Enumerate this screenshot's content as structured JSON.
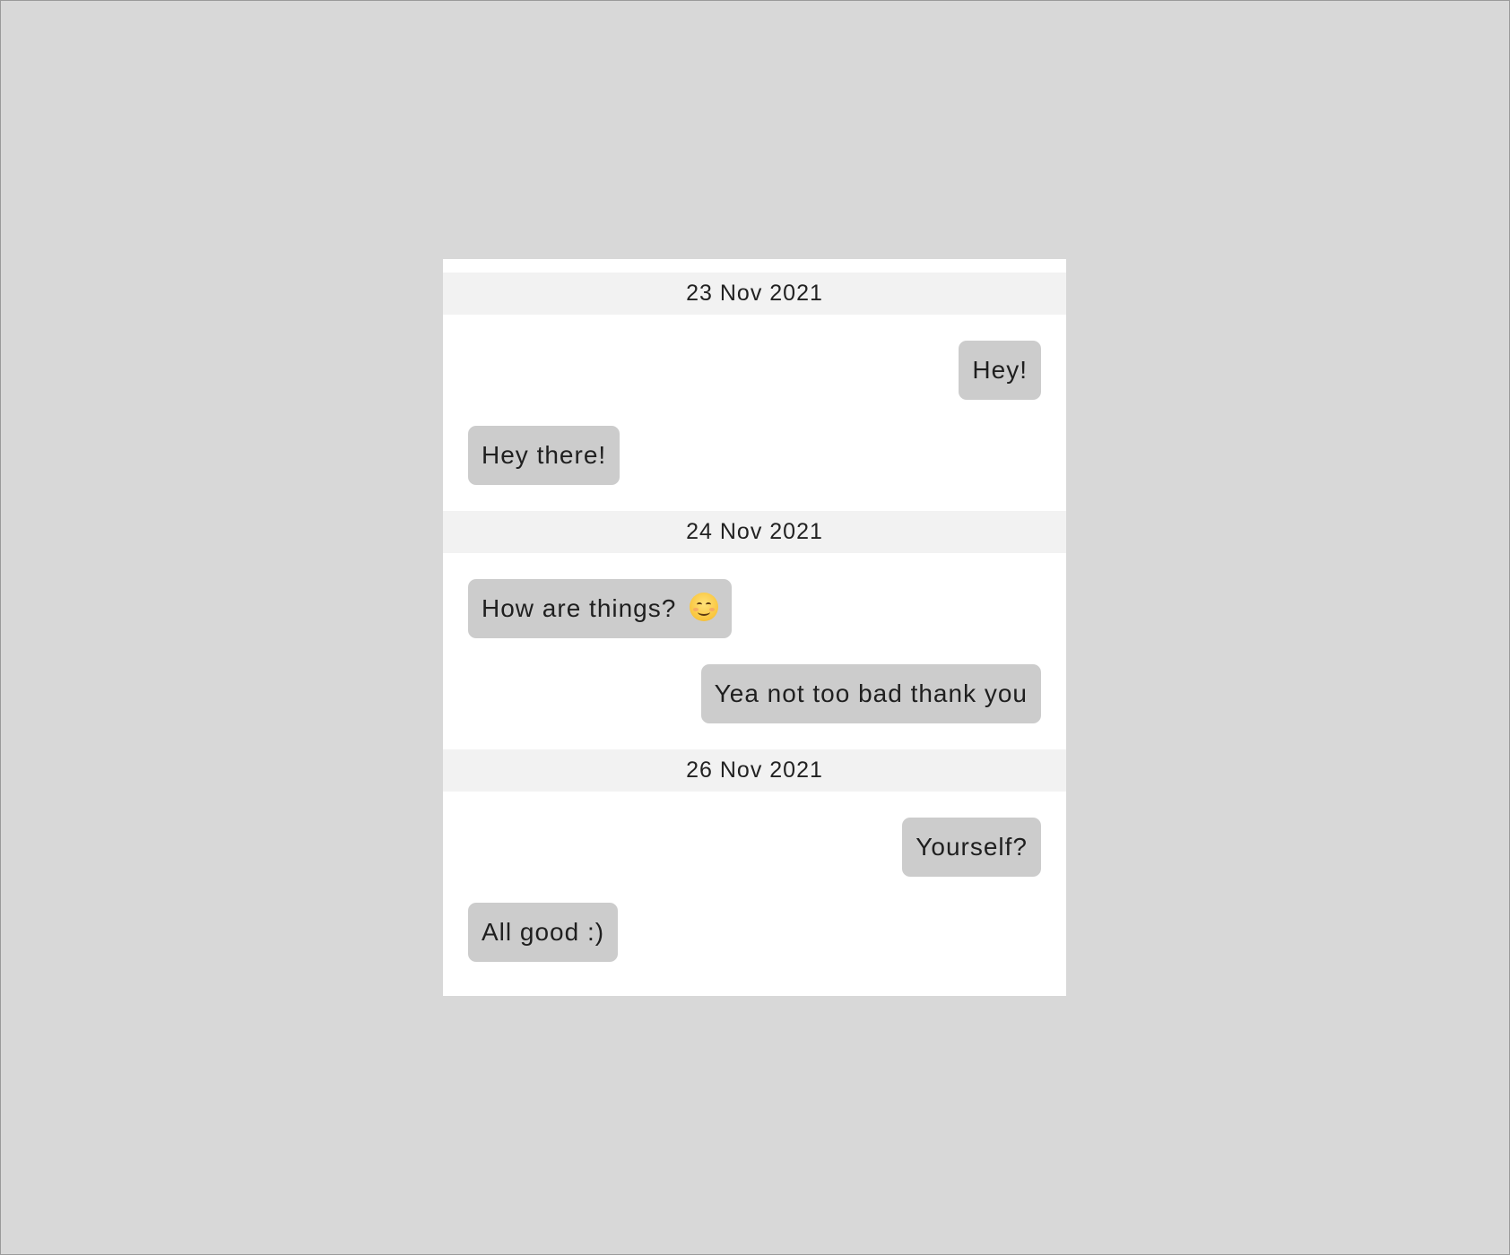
{
  "days": [
    {
      "date": "23 Nov 2021",
      "messages": [
        {
          "direction": "out",
          "text": "Hey!"
        },
        {
          "direction": "in",
          "text": "Hey there!"
        }
      ]
    },
    {
      "date": "24 Nov 2021",
      "messages": [
        {
          "direction": "in",
          "text": "How are things? ",
          "emoji": "smiling-face-emoji"
        },
        {
          "direction": "out",
          "text": "Yea not too bad thank you"
        }
      ]
    },
    {
      "date": "26 Nov 2021",
      "messages": [
        {
          "direction": "out",
          "text": "Yourself?"
        },
        {
          "direction": "in",
          "text": "All good :)"
        }
      ]
    }
  ],
  "colors": {
    "page_background": "#d8d8d8",
    "panel_background": "#ffffff",
    "date_header_background": "#f2f2f2",
    "bubble_background": "#cccccc",
    "text": "#1f1f1f"
  }
}
